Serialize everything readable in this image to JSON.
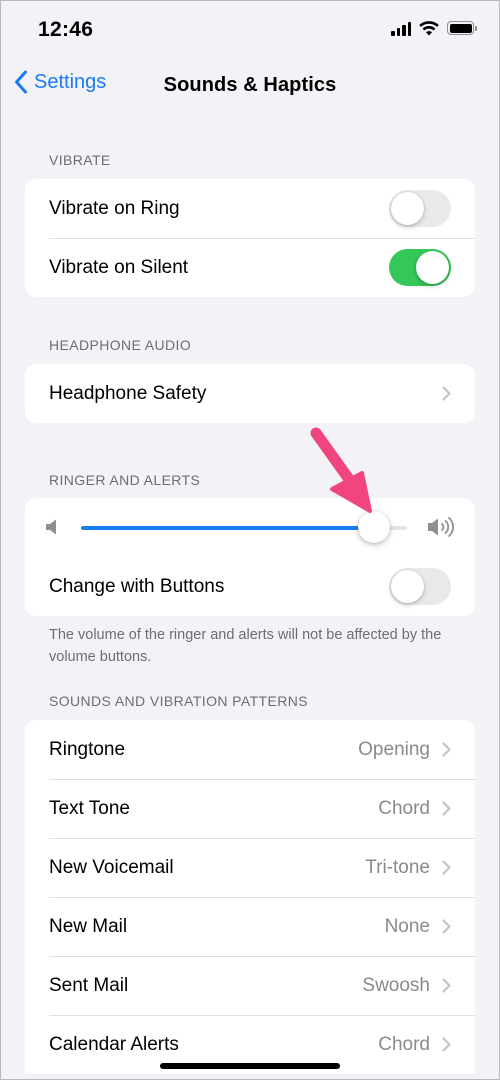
{
  "status_bar": {
    "time": "12:46",
    "icons": [
      "cellular-signal-icon",
      "wifi-icon",
      "battery-icon"
    ]
  },
  "nav": {
    "back_label": "Settings",
    "title": "Sounds & Haptics"
  },
  "colors": {
    "accent": "#1a7cf3",
    "toggle_on": "#34c759",
    "toggle_off": "#e9e9eb",
    "background": "#f2f2f7",
    "annotation_arrow": "#f0457f"
  },
  "vibrate": {
    "header": "VIBRATE",
    "rows": [
      {
        "label": "Vibrate on Ring",
        "toggle": false
      },
      {
        "label": "Vibrate on Silent",
        "toggle": true
      }
    ]
  },
  "headphone": {
    "header": "HEADPHONE AUDIO",
    "rows": [
      {
        "label": "Headphone Safety"
      }
    ]
  },
  "ringer": {
    "header": "RINGER AND ALERTS",
    "volume_level": 0.9,
    "icons": [
      "speaker-low-icon",
      "speaker-high-icon"
    ],
    "change_with_buttons": {
      "label": "Change with Buttons",
      "toggle": false
    },
    "footer": "The volume of the ringer and alerts will not be affected by the volume buttons."
  },
  "annotation": {
    "icon": "pink-arrow-icon"
  },
  "sounds": {
    "header": "SOUNDS AND VIBRATION PATTERNS",
    "rows": [
      {
        "label": "Ringtone",
        "value": "Opening"
      },
      {
        "label": "Text Tone",
        "value": "Chord"
      },
      {
        "label": "New Voicemail",
        "value": "Tri-tone"
      },
      {
        "label": "New Mail",
        "value": "None"
      },
      {
        "label": "Sent Mail",
        "value": "Swoosh"
      },
      {
        "label": "Calendar Alerts",
        "value": "Chord"
      }
    ]
  }
}
